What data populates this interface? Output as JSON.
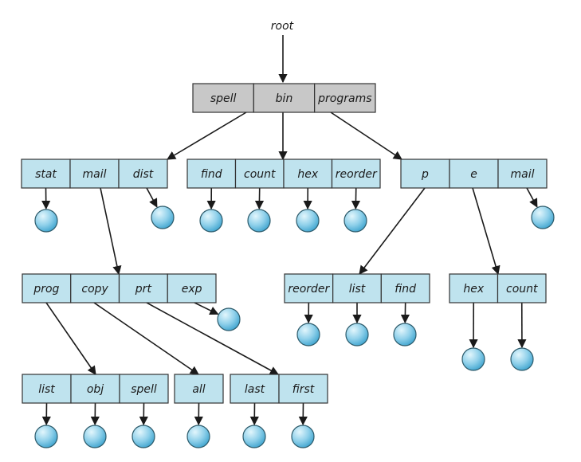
{
  "root_label": "root",
  "directories": [
    {
      "id": "root",
      "entries": [
        "spell",
        "bin",
        "programs"
      ],
      "kind": "root"
    },
    {
      "id": "spell",
      "entries": [
        "stat",
        "mail",
        "dist"
      ]
    },
    {
      "id": "bin",
      "entries": [
        "find",
        "count",
        "hex",
        "reorder"
      ]
    },
    {
      "id": "programs",
      "entries": [
        "p",
        "e",
        "mail"
      ]
    },
    {
      "id": "spell/mail",
      "entries": [
        "prog",
        "copy",
        "prt",
        "exp"
      ]
    },
    {
      "id": "programs/p",
      "entries": [
        "reorder",
        "list",
        "find"
      ]
    },
    {
      "id": "programs/e",
      "entries": [
        "hex",
        "count"
      ]
    },
    {
      "id": "spell/mail/prog",
      "entries": [
        "list",
        "obj",
        "spell"
      ]
    },
    {
      "id": "spell/mail/copy",
      "entries": [
        "all"
      ]
    },
    {
      "id": "spell/mail/prt",
      "entries": [
        "last",
        "first"
      ]
    }
  ],
  "links": [
    {
      "from": "root",
      "entry": "spell",
      "to": "spell"
    },
    {
      "from": "root",
      "entry": "bin",
      "to": "bin"
    },
    {
      "from": "root",
      "entry": "programs",
      "to": "programs"
    },
    {
      "from": "spell",
      "entry": "mail",
      "to": "spell/mail"
    },
    {
      "from": "programs",
      "entry": "p",
      "to": "programs/p"
    },
    {
      "from": "programs",
      "entry": "e",
      "to": "programs/e"
    },
    {
      "from": "spell/mail",
      "entry": "prog",
      "to": "spell/mail/prog"
    },
    {
      "from": "spell/mail",
      "entry": "copy",
      "to": "spell/mail/copy"
    },
    {
      "from": "spell/mail",
      "entry": "prt",
      "to": "spell/mail/prt"
    }
  ],
  "files": [
    {
      "dir": "spell",
      "entry": "stat"
    },
    {
      "dir": "spell",
      "entry": "dist"
    },
    {
      "dir": "bin",
      "entry": "find"
    },
    {
      "dir": "bin",
      "entry": "count"
    },
    {
      "dir": "bin",
      "entry": "hex"
    },
    {
      "dir": "bin",
      "entry": "reorder"
    },
    {
      "dir": "programs",
      "entry": "mail"
    },
    {
      "dir": "spell/mail",
      "entry": "exp"
    },
    {
      "dir": "programs/p",
      "entry": "reorder"
    },
    {
      "dir": "programs/p",
      "entry": "list"
    },
    {
      "dir": "programs/p",
      "entry": "find"
    },
    {
      "dir": "programs/e",
      "entry": "hex"
    },
    {
      "dir": "programs/e",
      "entry": "count"
    },
    {
      "dir": "spell/mail/prog",
      "entry": "list"
    },
    {
      "dir": "spell/mail/prog",
      "entry": "obj"
    },
    {
      "dir": "spell/mail/prog",
      "entry": "spell"
    },
    {
      "dir": "spell/mail/copy",
      "entry": "all"
    },
    {
      "dir": "spell/mail/prt",
      "entry": "last"
    },
    {
      "dir": "spell/mail/prt",
      "entry": "first"
    }
  ],
  "colors": {
    "root_fill": "#c8c8c8",
    "dir_fill": "#bfe3ee",
    "file_light": "#d8f1fa",
    "file_dark": "#4fb0d6"
  }
}
